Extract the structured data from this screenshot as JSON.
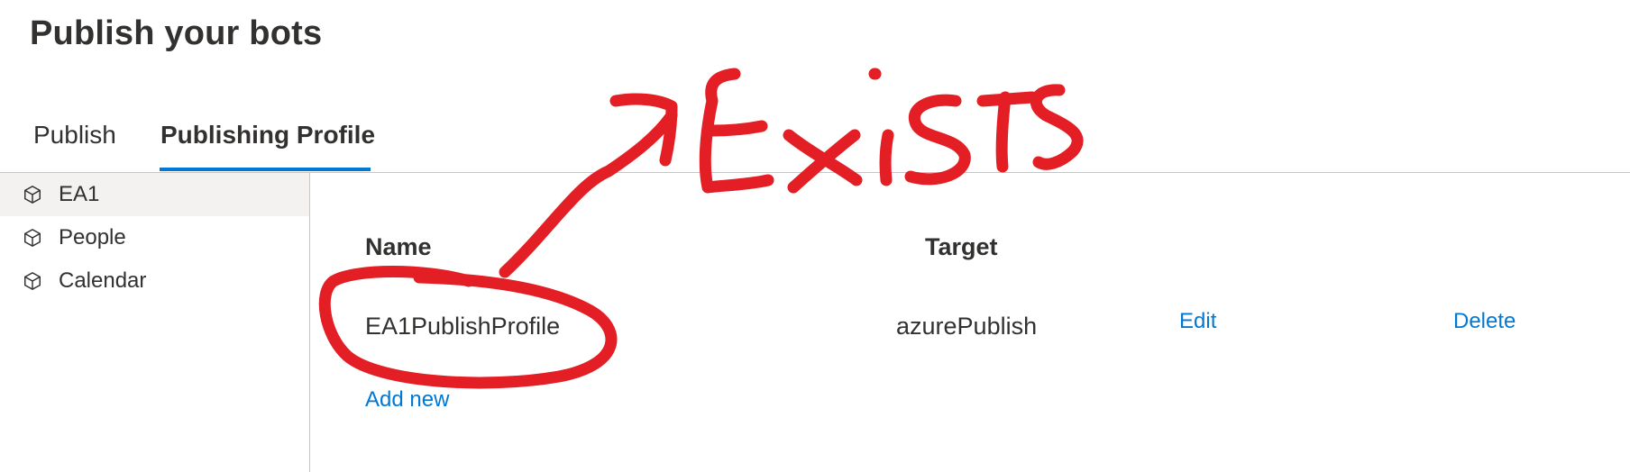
{
  "page": {
    "title": "Publish your bots"
  },
  "tabs": [
    {
      "label": "Publish",
      "selected": false
    },
    {
      "label": "Publishing Profile",
      "selected": true
    }
  ],
  "sidebar": {
    "items": [
      {
        "label": "EA1",
        "icon": "cube-icon",
        "selected": true
      },
      {
        "label": "People",
        "icon": "cube-icon",
        "selected": false
      },
      {
        "label": "Calendar",
        "icon": "cube-icon",
        "selected": false
      }
    ]
  },
  "table": {
    "columns": [
      "Name",
      "Target"
    ],
    "rows": [
      {
        "name": "EA1PublishProfile",
        "target": "azurePublish",
        "edit_label": "Edit",
        "delete_label": "Delete"
      }
    ],
    "add_new_label": "Add new"
  },
  "annotation": {
    "text": "Exists",
    "color": "#e31e24"
  },
  "colors": {
    "accent": "#0078d4",
    "text": "#323130",
    "selected_bg": "#f3f2f1",
    "divider": "#c8c6c4"
  }
}
